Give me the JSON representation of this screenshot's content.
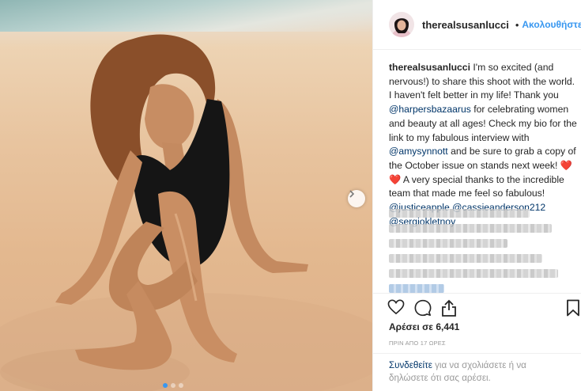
{
  "header": {
    "username": "therealsusanlucci",
    "separator": "•",
    "follow_label": "Ακολουθήστε"
  },
  "caption": {
    "username": "therealsusanlucci",
    "text1": "I'm so excited (and nervous!) to share this shoot with the world. I haven't felt better in my life! Thank you",
    "mention1": "@harpersbazaarus",
    "text2": "for celebrating women and beauty at all ages! Check my bio for the link to my fabulous interview with",
    "mention2": "@amysynnott",
    "text3": "and be sure to grab a copy of the October issue on stands next week! ❤️❤️ A very special thanks to the incredible team that made me feel so fabulous!",
    "mention3": "@justiceapple",
    "mention4": "@cassieanderson212",
    "mention5": "@sergiokletnoy"
  },
  "likes": "Αρέσει σε 6,441",
  "timestamp": "ΠΡΙΝ ΑΠΟ 17 ΩΡΕΣ",
  "login_prompt": {
    "link": "Συνδεθείτε",
    "text": "για να σχολιάσετε ή να δηλώσετε ότι σας αρέσει."
  },
  "icons": {
    "verified": "verified-badge-icon",
    "like": "heart-icon",
    "comment": "comment-icon",
    "share": "share-icon",
    "save": "bookmark-icon",
    "next": "chevron-right-icon"
  },
  "carousel": {
    "slides": 3,
    "active_index": 0
  },
  "colors": {
    "link": "#3897f0",
    "mention": "#003569",
    "muted": "#999999",
    "text": "#262626"
  }
}
